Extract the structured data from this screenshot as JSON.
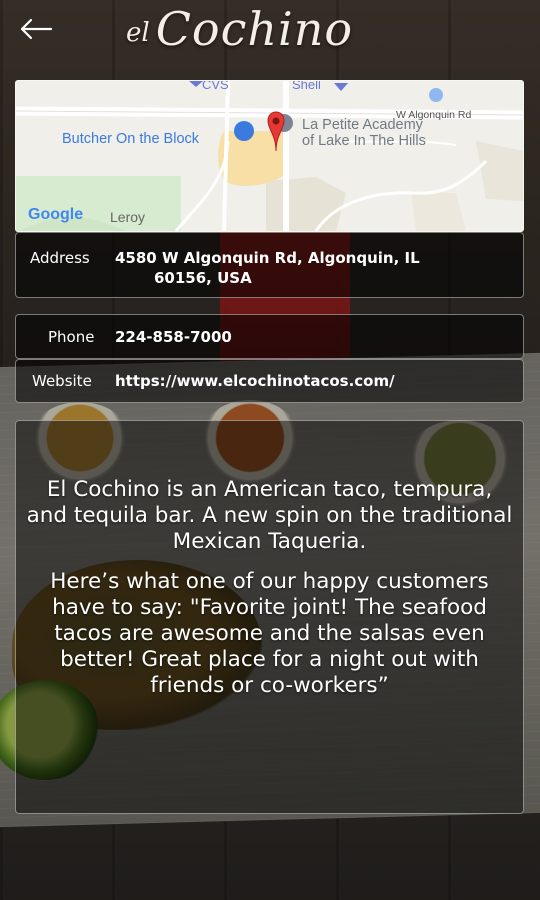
{
  "header": {
    "logo_prefix": "el",
    "logo_name": "Cochino"
  },
  "map": {
    "labels": {
      "cvs": "CVS",
      "shell": "Shell",
      "road": "W Algonquin Rd",
      "butcher": "Butcher On the Block",
      "academy_line1": "La Petite Academy",
      "academy_line2": "of Lake In The Hills",
      "leroy": "Leroy",
      "google": "Google"
    }
  },
  "address": {
    "label": "Address",
    "line1": "4580 W Algonquin Rd, Algonquin, IL",
    "line2": "60156, USA"
  },
  "phone": {
    "label": "Phone",
    "value": "224-858-7000"
  },
  "website": {
    "label": "Website",
    "value": "https://www.elcochinotacos.com/"
  },
  "description": {
    "paragraph1": "El Cochino is an American taco, tempura, and tequila bar. A new spin on the traditional Mexican Taqueria.",
    "paragraph2": "Here’s what one of our happy customers have to say: \"Favorite joint! The seafood tacos are awesome and the salsas even better! Great place for a night out with friends or co-workers”"
  },
  "colors": {
    "map_pin": "#e53935",
    "poi_blue": "#3b7be0",
    "road_yellow": "#f7d98a"
  },
  "icons": {
    "back": "arrow-left-icon",
    "pin": "map-pin-icon"
  }
}
